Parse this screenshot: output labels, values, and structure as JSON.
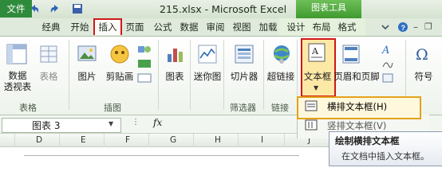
{
  "window": {
    "title": "215.xlsx - Microsoft Excel",
    "context_title": "图表工具"
  },
  "tabs": {
    "file": "文件",
    "tab2": "经典",
    "home": "开始",
    "insert": "插入",
    "page": "页面",
    "formulas": "公式",
    "data": "数据",
    "review": "审阅",
    "view": "视图",
    "addins": "加载",
    "design": "设计",
    "layout": "布局",
    "format": "格式"
  },
  "ribbon": {
    "data_pivot": "数据\n透视表",
    "table": "表格",
    "picture": "图片",
    "clipart": "剪贴画",
    "chart": "图表",
    "sparkline": "迷你图",
    "slicer": "切片器",
    "hyperlink": "超链接",
    "textbox": "文本框",
    "header_footer": "页眉和页脚",
    "symbol": "符号",
    "groups": {
      "tables": "表格",
      "illustrations": "插图",
      "filter": "筛选器",
      "links": "链接"
    }
  },
  "dropdown": {
    "horizontal": "横排文本框(H)",
    "vertical": "竖排文本框(V)"
  },
  "formula_bar": {
    "name_box": "图表 3",
    "fx": "fx"
  },
  "columns": [
    "D",
    "E",
    "F",
    "G",
    "H",
    "I",
    "J"
  ],
  "tooltip": {
    "title": "绘制横排文本框",
    "desc": "在文档中插入文本框。"
  }
}
